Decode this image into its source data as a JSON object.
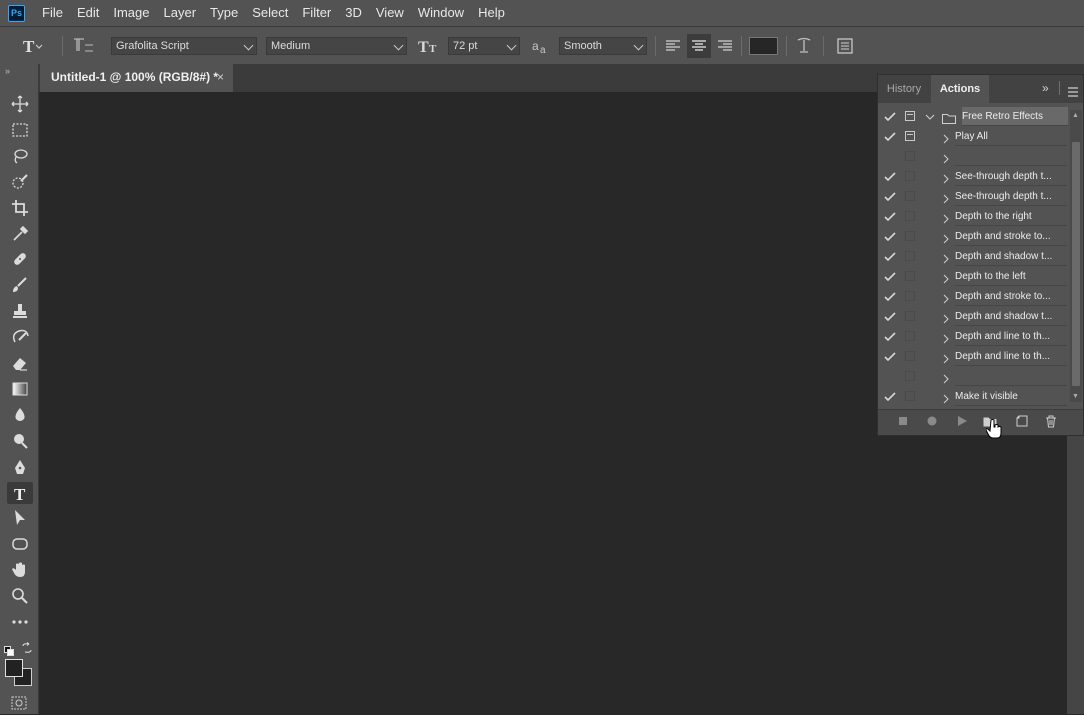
{
  "menubar": {
    "logo_text": "Ps",
    "items": [
      "File",
      "Edit",
      "Image",
      "Layer",
      "Type",
      "Select",
      "Filter",
      "3D",
      "View",
      "Window",
      "Help"
    ]
  },
  "options": {
    "font_family": "Grafolita Script",
    "font_style": "Medium",
    "font_size": "72 pt",
    "antialias": "Smooth",
    "antialias_icon_text": "a",
    "text_color": "#262626"
  },
  "document": {
    "tab_title": "Untitled-1 @ 100% (RGB/8#) *",
    "close_glyph": "×"
  },
  "panel": {
    "tab_history": "History",
    "tab_actions": "Actions",
    "rows": [
      {
        "checked": true,
        "dialog": true,
        "type": "set",
        "label": "Free Retro Effects"
      },
      {
        "checked": true,
        "dialog": true,
        "type": "action",
        "label": "Play All"
      },
      {
        "checked": false,
        "dialog": false,
        "type": "action",
        "label": ""
      },
      {
        "checked": true,
        "dialog": false,
        "type": "action",
        "label": "See-through depth t..."
      },
      {
        "checked": true,
        "dialog": false,
        "type": "action",
        "label": "See-through depth t..."
      },
      {
        "checked": true,
        "dialog": false,
        "type": "action",
        "label": "Depth to the right"
      },
      {
        "checked": true,
        "dialog": false,
        "type": "action",
        "label": "Depth and stroke to..."
      },
      {
        "checked": true,
        "dialog": false,
        "type": "action",
        "label": "Depth and shadow t..."
      },
      {
        "checked": true,
        "dialog": false,
        "type": "action",
        "label": "Depth to the left"
      },
      {
        "checked": true,
        "dialog": false,
        "type": "action",
        "label": "Depth and stroke to..."
      },
      {
        "checked": true,
        "dialog": false,
        "type": "action",
        "label": "Depth and shadow t..."
      },
      {
        "checked": true,
        "dialog": false,
        "type": "action",
        "label": "Depth and line to th..."
      },
      {
        "checked": true,
        "dialog": false,
        "type": "action",
        "label": "Depth and line to th..."
      },
      {
        "checked": false,
        "dialog": false,
        "type": "action",
        "label": ""
      },
      {
        "checked": true,
        "dialog": false,
        "type": "action",
        "label": "Make it visible"
      }
    ]
  },
  "colors": {
    "foreground": "#222222",
    "background": "#222222"
  },
  "toolbar": {
    "tools": [
      "move-tool",
      "marquee-tool",
      "lasso-tool",
      "quick-select-tool",
      "crop-tool",
      "eyedropper-tool",
      "healing-tool",
      "brush-tool",
      "clone-stamp-tool",
      "history-brush-tool",
      "eraser-tool",
      "gradient-tool",
      "blur-tool",
      "dodge-tool",
      "pen-tool",
      "type-tool",
      "path-select-tool",
      "shape-tool",
      "hand-tool",
      "zoom-tool",
      "more-tools"
    ],
    "active": "type-tool"
  }
}
